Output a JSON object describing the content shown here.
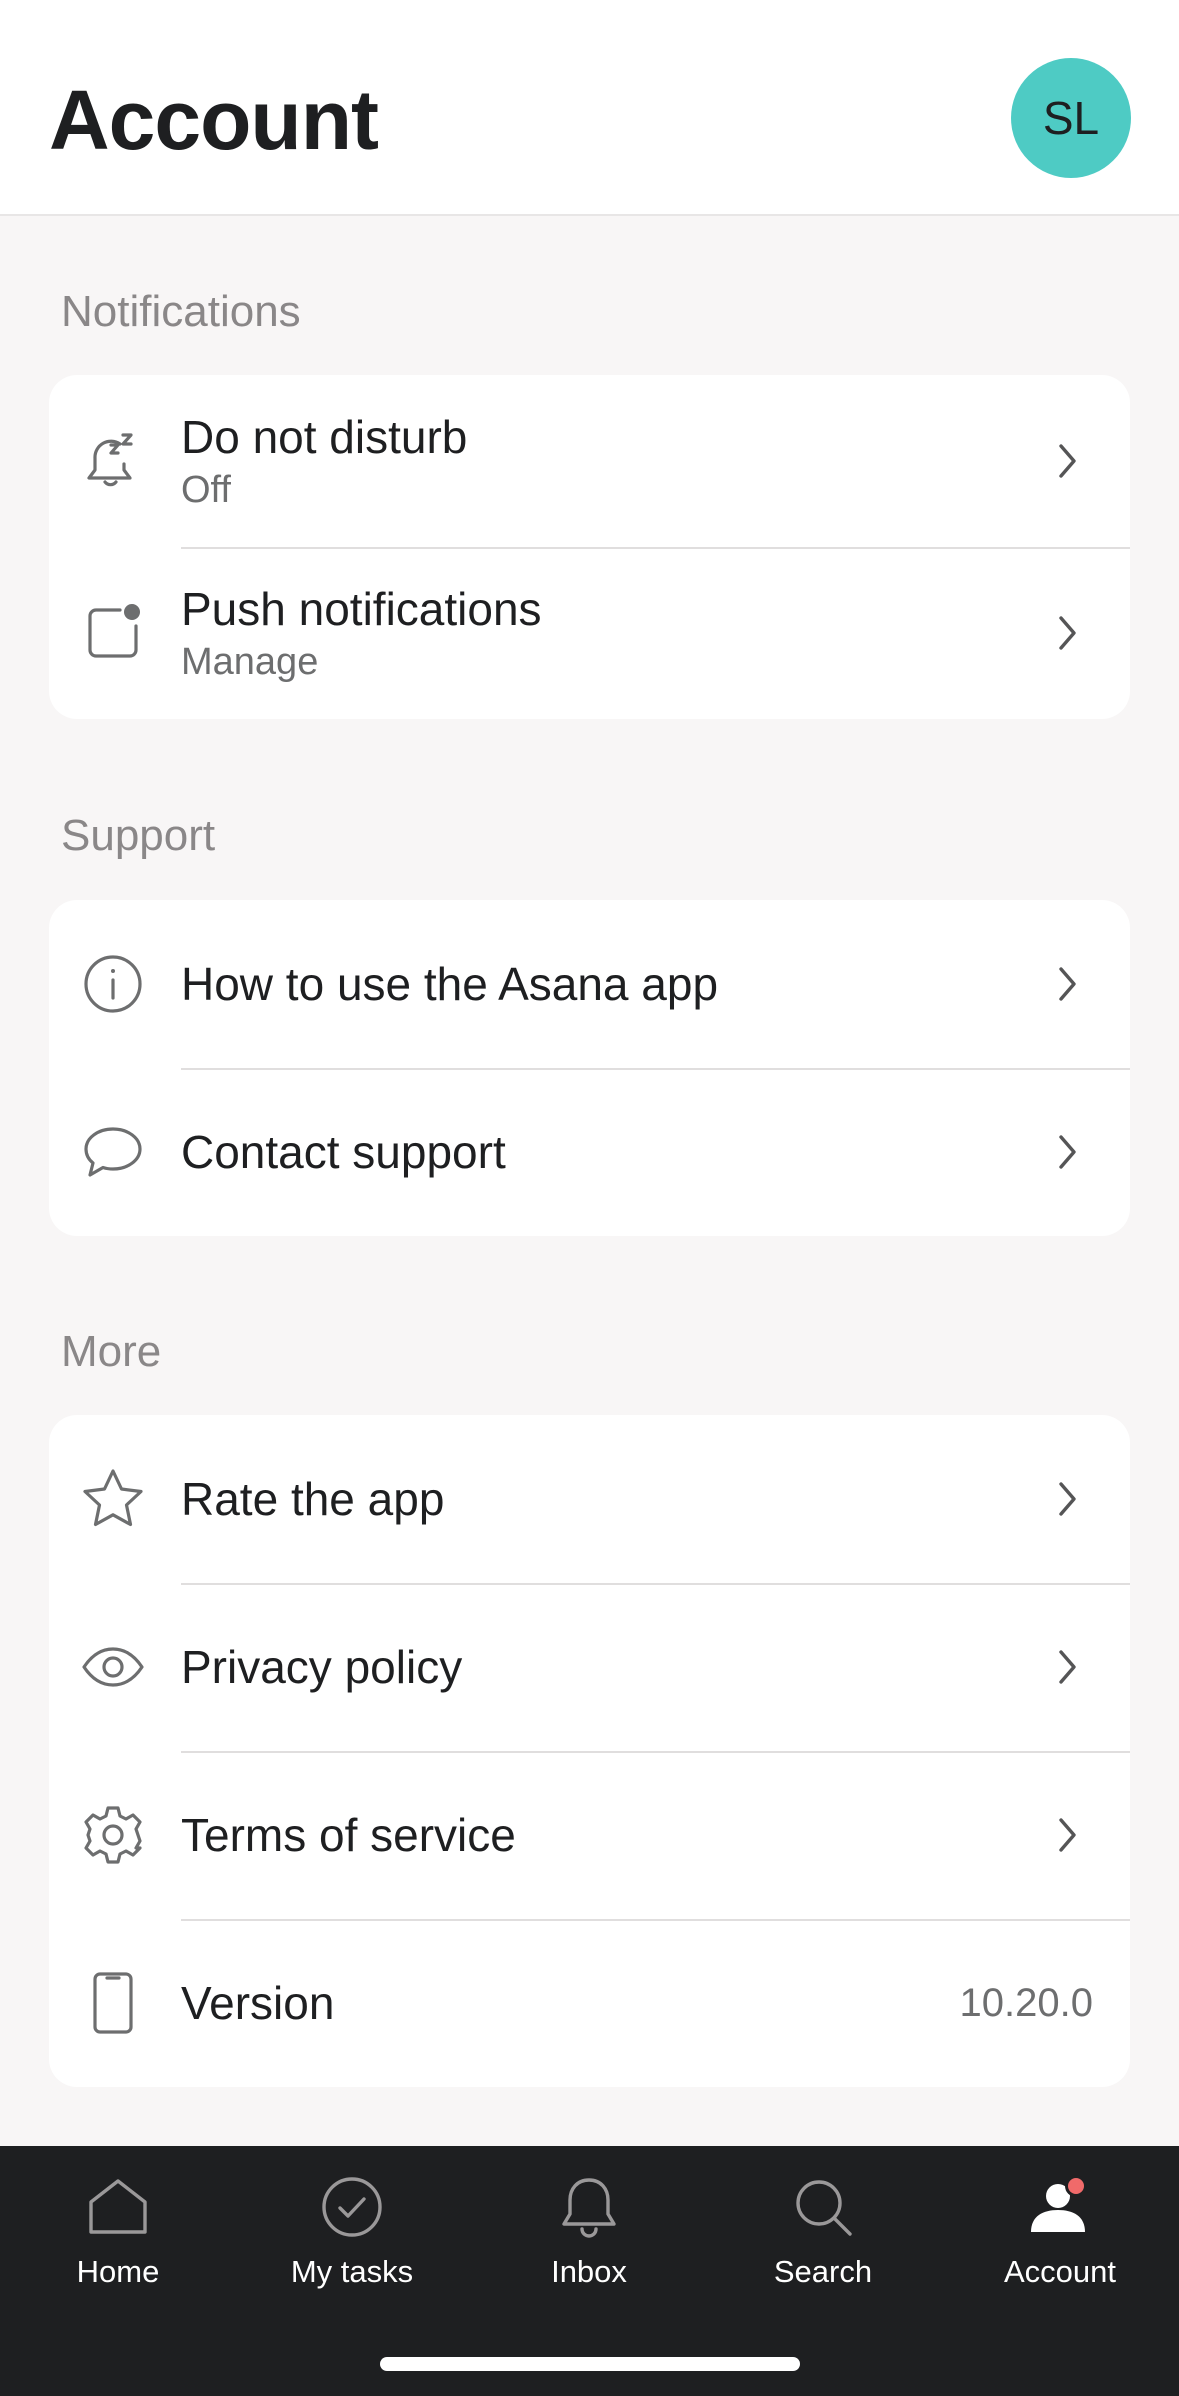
{
  "header": {
    "title": "Account",
    "avatar_initials": "SL",
    "avatar_color": "#4ecbc4"
  },
  "sections": {
    "notifications": {
      "label": "Notifications",
      "items": [
        {
          "title": "Do not disturb",
          "subtitle": "Off",
          "icon": "bell-snooze-icon"
        },
        {
          "title": "Push notifications",
          "subtitle": "Manage",
          "icon": "push-notification-icon"
        }
      ]
    },
    "support": {
      "label": "Support",
      "items": [
        {
          "title": "How to use the Asana app",
          "icon": "info-icon"
        },
        {
          "title": "Contact support",
          "icon": "chat-bubble-icon"
        }
      ]
    },
    "more": {
      "label": "More",
      "items": [
        {
          "title": "Rate the app",
          "icon": "star-icon"
        },
        {
          "title": "Privacy policy",
          "icon": "eye-icon"
        },
        {
          "title": "Terms of service",
          "icon": "gear-icon"
        },
        {
          "title": "Version",
          "value": "10.20.0",
          "icon": "phone-icon"
        }
      ]
    }
  },
  "tabbar": {
    "tabs": [
      {
        "label": "Home",
        "icon": "home-icon"
      },
      {
        "label": "My tasks",
        "icon": "check-circle-icon"
      },
      {
        "label": "Inbox",
        "icon": "bell-icon"
      },
      {
        "label": "Search",
        "icon": "search-icon"
      },
      {
        "label": "Account",
        "icon": "account-icon",
        "active": true
      }
    ],
    "badge_color": "#f06a6a"
  }
}
